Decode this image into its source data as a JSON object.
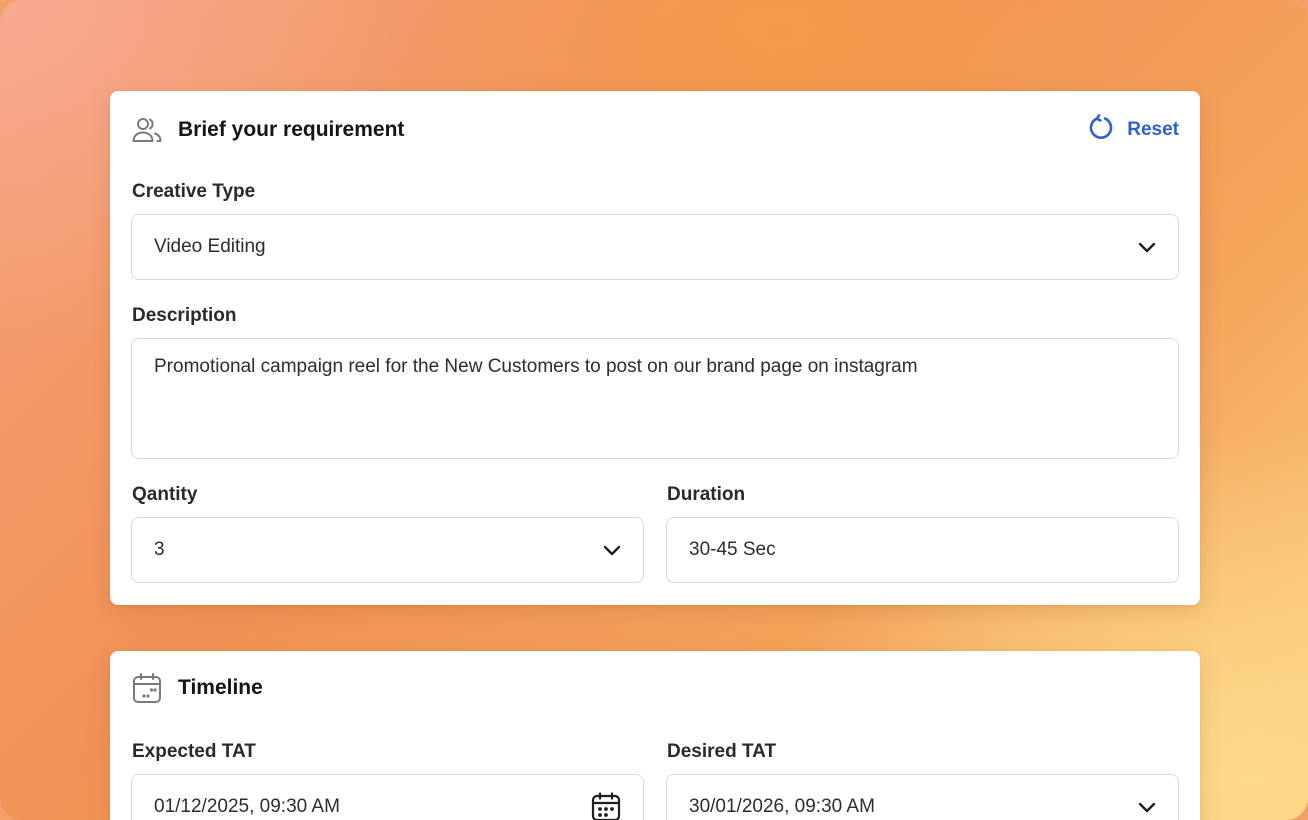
{
  "brief": {
    "title": "Brief your requirement",
    "reset_label": "Reset",
    "creative_type": {
      "label": "Creative Type",
      "value": "Video Editing"
    },
    "description": {
      "label": "Description",
      "value": "Promotional campaign reel for the New Customers to post on our brand page on instagram"
    },
    "quantity": {
      "label": "Qantity",
      "value": "3"
    },
    "duration": {
      "label": "Duration",
      "value": "30-45 Sec"
    },
    "icons": {
      "header": "users-icon",
      "reset": "refresh-icon",
      "dropdown": "chevron-down-icon"
    }
  },
  "timeline": {
    "title": "Timeline",
    "expected_tat": {
      "label": "Expected TAT",
      "value": "01/12/2025, 09:30 AM"
    },
    "desired_tat": {
      "label": "Desired TAT",
      "value": "30/01/2026, 09:30 AM"
    },
    "icons": {
      "header": "calendar-icon",
      "picker": "calendar-icon",
      "dropdown": "chevron-down-icon"
    }
  },
  "colors": {
    "accent": "#2f5fd0",
    "border": "#d9d9d9",
    "text": "#2d2d2d"
  }
}
